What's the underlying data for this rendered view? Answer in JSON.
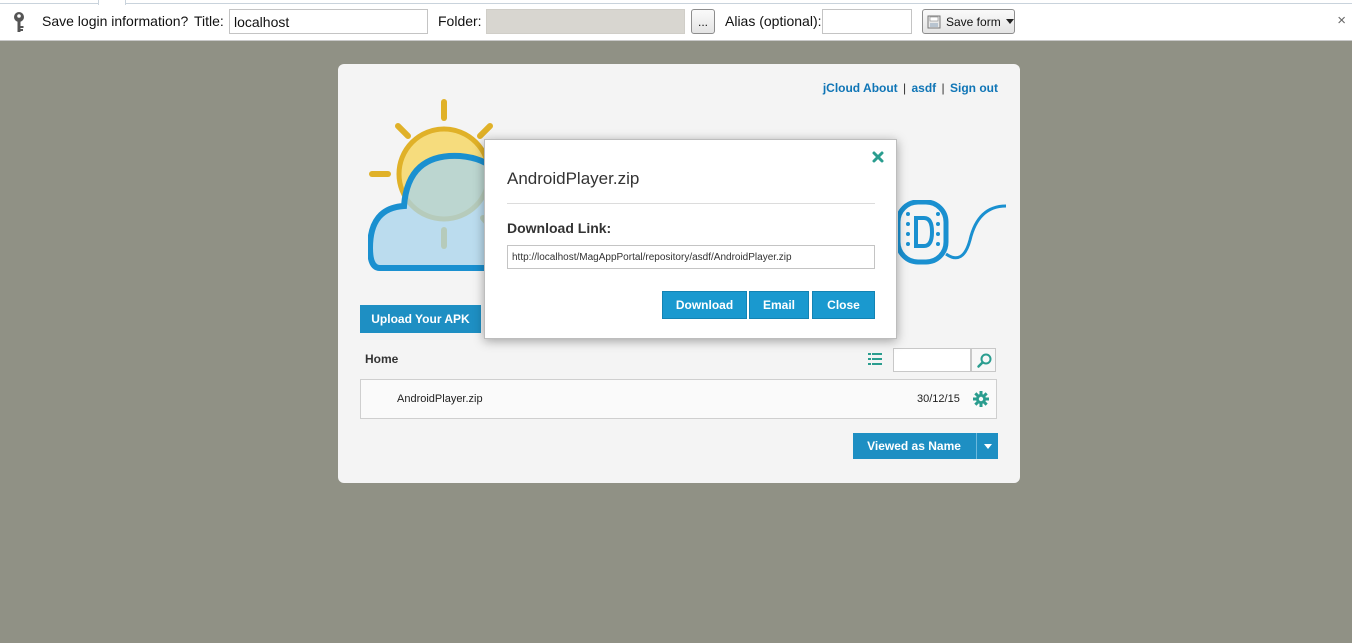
{
  "pwbar": {
    "prompt": "Save login information?",
    "title_label": "Title:",
    "title_value": "localhost",
    "folder_label": "Folder:",
    "folder_value": "",
    "browse_label": "...",
    "alias_label": "Alias (optional):",
    "alias_value": "",
    "save_form_label": "Save form",
    "close_label": "×"
  },
  "page": {
    "links": {
      "about": "jCloud About",
      "sep1": "|",
      "user": "asdf",
      "sep2": "|",
      "signout": "Sign out"
    },
    "upload_label": "Upload Your APK",
    "breadcrumb": "Home",
    "search_placeholder": "",
    "files": [
      {
        "name": "AndroidPlayer.zip",
        "date": "30/12/15"
      }
    ],
    "view_mode_label": "Viewed as Name"
  },
  "modal": {
    "title": "AndroidPlayer.zip",
    "link_label": "Download Link:",
    "link_value": "http://localhost/MagAppPortal/repository/asdf/AndroidPlayer.zip",
    "buttons": {
      "download": "Download",
      "email": "Email",
      "close": "Close"
    }
  },
  "colors": {
    "accent": "#1e8fc3",
    "modal_button": "#1a99cf",
    "link": "#0f75b6",
    "teal_icon": "#2a9d8f"
  },
  "icons": {
    "pwbar": "key-icon",
    "modal_close": "close-icon",
    "list_view": "list-icon",
    "search": "search-icon",
    "row_menu": "gear-icon",
    "view_mode": "chevron-down-icon"
  }
}
